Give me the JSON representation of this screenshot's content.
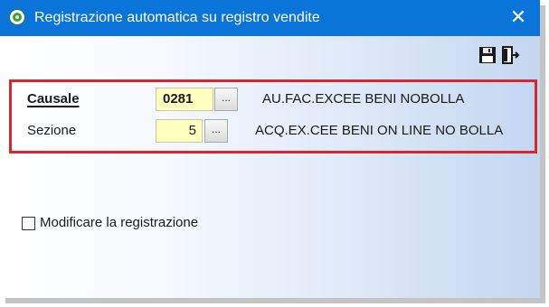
{
  "window": {
    "title": "Registrazione automatica su registro vendite",
    "close_glyph": "✕"
  },
  "toolbar": {
    "save_icon": "floppy-disk-icon",
    "exit_icon": "exit-door-icon"
  },
  "form": {
    "causale": {
      "label": "Causale",
      "value": "0281",
      "lookup_label": "...",
      "description": "AU.FAC.EXCEE BENI NOBOLLA"
    },
    "sezione": {
      "label": "Sezione",
      "value": "5",
      "lookup_label": "...",
      "description": "ACQ.EX.CEE BENI ON LINE NO BOLLA"
    }
  },
  "options": {
    "modify_label": "Modificare la registrazione",
    "modify_checked": false
  },
  "colors": {
    "titlebar": "#0a74d8",
    "highlight_frame": "#d6262e",
    "field_background": "#ffffc0"
  }
}
